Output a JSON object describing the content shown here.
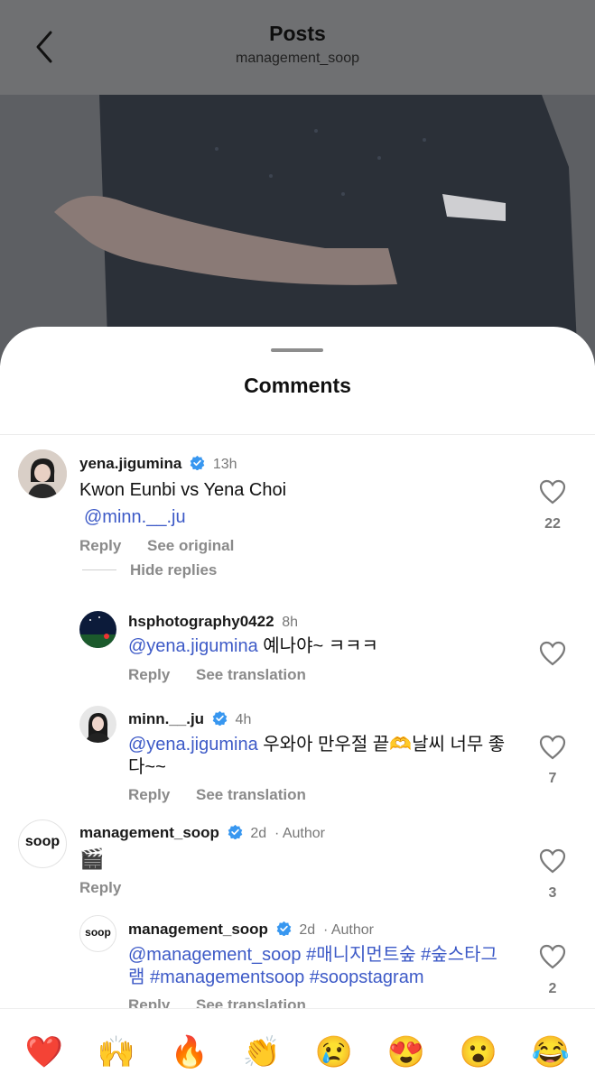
{
  "header": {
    "title": "Posts",
    "subtitle": "management_soop"
  },
  "sheet": {
    "title": "Comments"
  },
  "comments": [
    {
      "username": "yena.jigumina",
      "time": "13h",
      "line1": "Kwon Eunbi vs Yena Choi",
      "mention": "@minn.__.ju",
      "reply": "Reply",
      "see": "See original",
      "hide_replies": "Hide replies",
      "likes": "22"
    },
    {
      "username": "hsphotography0422",
      "time": "8h",
      "mention": "@yena.jigumina",
      "text": " 예나야~ ㅋㅋㅋ",
      "reply": "Reply",
      "see": "See translation"
    },
    {
      "username": "minn.__.ju",
      "time": "4h",
      "mention": "@yena.jigumina",
      "text": " 우와아 만우절 끝🫶날씨 너무 좋다~~",
      "reply": "Reply",
      "see": "See translation",
      "likes": "7"
    },
    {
      "username": "management_soop",
      "time": "2d",
      "author": "· Author",
      "text": "🎬",
      "reply": "Reply",
      "likes": "3",
      "avatar_text": "soop"
    },
    {
      "username": "management_soop",
      "time": "2d",
      "author": "· Author",
      "tags": "@management_soop #매니지먼트숲 #숲스타그램 #managementsoop #soopstagram",
      "reply": "Reply",
      "see": "See translation",
      "likes": "2",
      "avatar_text": "soop"
    }
  ],
  "emoji_bar": [
    "❤️",
    "🙌",
    "🔥",
    "👏",
    "😢",
    "😍",
    "😮",
    "😂"
  ],
  "colors": {
    "verified": "#3897f0",
    "mention": "#3d5ac7",
    "overlay": "#6f7072"
  }
}
